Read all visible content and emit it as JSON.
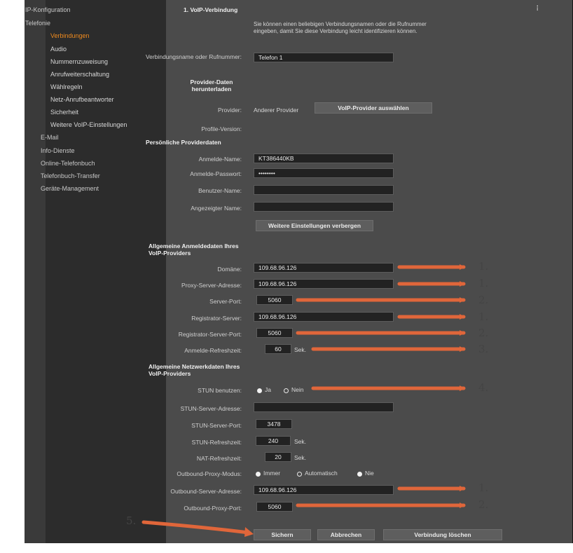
{
  "sidebar": {
    "items": [
      {
        "label": "IP-Konfiguration",
        "level": 0
      },
      {
        "label": "Telefonie",
        "level": 0
      },
      {
        "label": "Verbindungen",
        "level": 1,
        "active": true
      },
      {
        "label": "Audio",
        "level": 1
      },
      {
        "label": "Nummernzuweisung",
        "level": 1
      },
      {
        "label": "Anrufweiterschaltung",
        "level": 1
      },
      {
        "label": "Wählregeln",
        "level": 1
      },
      {
        "label": "Netz-Anrufbeantworter",
        "level": 1
      },
      {
        "label": "Sicherheit",
        "level": 1
      },
      {
        "label": "Weitere VoIP-Einstellungen",
        "level": 1
      },
      {
        "label": "E-Mail",
        "level": 0
      },
      {
        "label": "Info-Dienste",
        "level": 0
      },
      {
        "label": "Online-Telefonbuch",
        "level": 0
      },
      {
        "label": "Telefonbuch-Transfer",
        "level": 0
      },
      {
        "label": "Geräte-Management",
        "level": 0
      }
    ]
  },
  "form": {
    "title": "1. VoIP-Verbindung",
    "intro": "Sie können einen beliebigen Verbindungsnamen oder die Rufnummer eingeben, damit Sie diese Verbindung leicht identifizieren können.",
    "connection_name": {
      "label": "Verbindungsname oder Rufnummer:",
      "value": "Telefon 1"
    },
    "provider_section": "Provider-Daten herunterladen",
    "provider": {
      "label": "Provider:",
      "value": "Anderer Provider",
      "button": "VoIP-Provider auswählen"
    },
    "profile_version": {
      "label": "Profile-Version:"
    },
    "personal_section": "Persönliche Providerdaten",
    "login_name": {
      "label": "Anmelde-Name:",
      "value": "KT386440KB"
    },
    "login_password": {
      "label": "Anmelde-Passwort:",
      "value": "••••••••"
    },
    "user_name": {
      "label": "Benutzer-Name:",
      "value": ""
    },
    "display_name": {
      "label": "Angezeigter Name:",
      "value": ""
    },
    "hide_button": "Weitere Einstellungen verbergen",
    "general_login_section": "Allgemeine Anmeldedaten Ihres VoIP-Providers",
    "domain": {
      "label": "Domäne:",
      "value": "109.68.96.126"
    },
    "proxy_server": {
      "label": "Proxy-Server-Adresse:",
      "value": "109.68.96.126"
    },
    "server_port": {
      "label": "Server-Port:",
      "value": "5060"
    },
    "registrar": {
      "label": "Registrator-Server:",
      "value": "109.68.96.126"
    },
    "registrar_port": {
      "label": "Registrator-Server-Port:",
      "value": "5060"
    },
    "login_refresh": {
      "label": "Anmelde-Refreshzeit:",
      "value": "60",
      "unit": "Sek."
    },
    "general_net_section": "Allgemeine Netzwerkdaten Ihres VoIP-Providers",
    "stun_use": {
      "label": "STUN benutzen:",
      "yes": "Ja",
      "no": "Nein",
      "selected": "Ja"
    },
    "stun_server": {
      "label": "STUN-Server-Adresse:",
      "value": ""
    },
    "stun_port": {
      "label": "STUN-Server-Port:",
      "value": "3478"
    },
    "stun_refresh": {
      "label": "STUN-Refreshzeit:",
      "value": "240",
      "unit": "Sek."
    },
    "nat_refresh": {
      "label": "NAT-Refreshzeit:",
      "value": "20",
      "unit": "Sek."
    },
    "outbound_mode": {
      "label": "Outbound-Proxy-Modus:",
      "opt1": "Immer",
      "opt2": "Automatisch",
      "opt3": "Nie",
      "selected": "Immer"
    },
    "outbound_server": {
      "label": "Outbound-Server-Adresse:",
      "value": "109.68.96.126"
    },
    "outbound_port": {
      "label": "Outbound-Proxy-Port:",
      "value": "5060"
    },
    "buttons": {
      "save": "Sichern",
      "cancel": "Abbrechen",
      "delete": "Verbindung löschen"
    }
  },
  "annotations": {
    "n1": "1.",
    "n2": "2.",
    "n3": "3.",
    "n4": "4.",
    "n5": "5.",
    "arrow_color": "#e0663a"
  },
  "colors": {
    "accent": "#ee8a1e",
    "panel": "#4b4b4b",
    "sidebar": "#2c2c2c"
  }
}
